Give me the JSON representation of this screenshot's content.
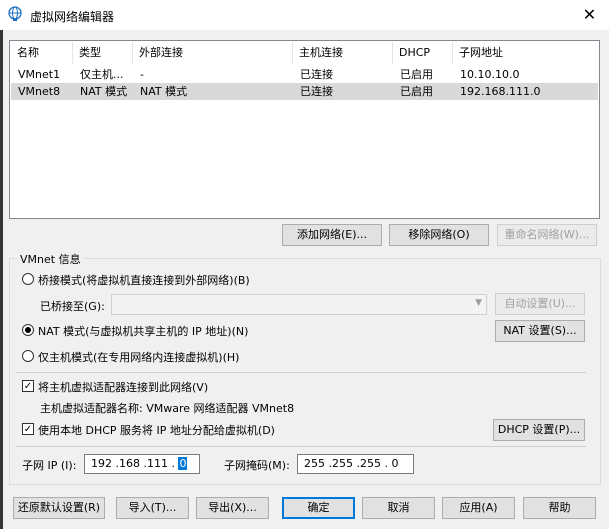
{
  "window": {
    "title": "虚拟网络编辑器",
    "close_glyph": "✕"
  },
  "table": {
    "columns": [
      "名称",
      "类型",
      "外部连接",
      "主机连接",
      "DHCP",
      "子网地址"
    ],
    "rows": [
      [
        "VMnet1",
        "仅主机...",
        "-",
        "已连接",
        "已启用",
        "10.10.10.0"
      ],
      [
        "VMnet8",
        "NAT 模式",
        "NAT 模式",
        "已连接",
        "已启用",
        "192.168.111.0"
      ]
    ],
    "selected_row": 1
  },
  "table_buttons": {
    "add": "添加网络(E)...",
    "remove": "移除网络(O)",
    "rename": "重命名网络(W)..."
  },
  "vmnet_info": {
    "group_label": "VMnet 信息",
    "bridged_label": "桥接模式(将虚拟机直接连接到外部网络)(B)",
    "bridged_to_label": "已桥接至(G):",
    "bridged_to_value": "",
    "auto_settings": "自动设置(U)...",
    "nat_label": "NAT 模式(与虚拟机共享主机的 IP 地址)(N)",
    "nat_settings": "NAT 设置(S)...",
    "hostonly_label": "仅主机模式(在专用网络内连接虚拟机)(H)",
    "selected_mode": "nat",
    "connect_adapter_label": "将主机虚拟适配器连接到此网络(V)",
    "connect_adapter_checked": true,
    "adapter_name_label": "主机虚拟适配器名称: VMware 网络适配器 VMnet8",
    "dhcp_label": "使用本地 DHCP 服务将 IP 地址分配给虚拟机(D)",
    "dhcp_checked": true,
    "dhcp_settings": "DHCP 设置(P)...",
    "subnet_ip_label": "子网 IP (I):",
    "subnet_ip_prefix": "192 .168 .111 . ",
    "subnet_ip_last": "0",
    "subnet_mask_label": "子网掩码(M):",
    "subnet_mask": "255 .255 .255 . 0"
  },
  "bottom_buttons": {
    "restore": "还原默认设置(R)",
    "import": "导入(T)...",
    "export": "导出(X)...",
    "ok": "确定",
    "cancel": "取消",
    "apply": "应用(A)",
    "help": "帮助"
  },
  "icons": {
    "title_icon": "globe-network-icon"
  }
}
